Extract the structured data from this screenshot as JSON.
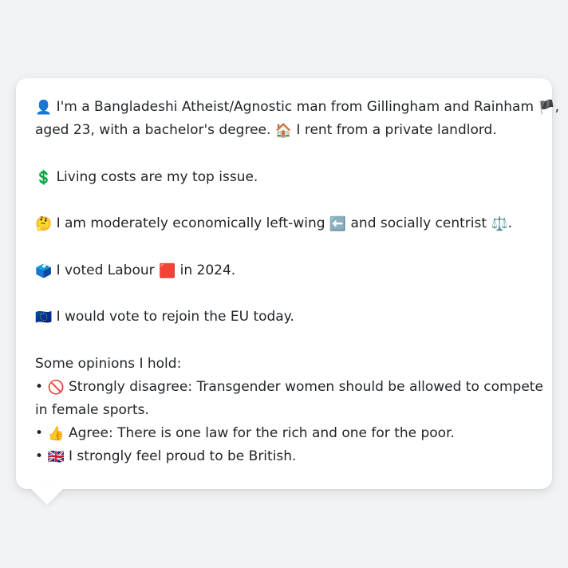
{
  "profile": {
    "line1_icon": "👤",
    "line1_text": "I'm a Bangladeshi Atheist/Agnostic man from Gillingham and Rainham",
    "line1_flag": "🏴",
    "line1_suffix": ",",
    "line2_text": "aged 23, with a bachelor's degree.",
    "line2_house_icon": "🏠",
    "line2_rest": "I rent from a private landlord."
  },
  "issue": {
    "icon": "💲",
    "text": "Living costs are my top issue."
  },
  "ideology": {
    "think_icon": "🤔",
    "text_a": "I am moderately economically left-wing",
    "left_arrow_icon": "⬅️",
    "text_b": "and socially centrist",
    "scales_icon": "⚖️",
    "text_end": "."
  },
  "vote": {
    "ballot_icon": "🗳️",
    "text_a": "I voted Labour",
    "party_square_icon": "🟥",
    "text_b": "in 2024."
  },
  "eu": {
    "flag_icon": "🇪🇺",
    "text": "I would vote to rejoin the EU today."
  },
  "opinions": {
    "heading": "Some opinions I hold:",
    "items": [
      {
        "bullet": "•",
        "icon": "🚫",
        "text_line1": "Strongly disagree: Transgender women should be allowed to compete",
        "text_line2": "in female sports."
      },
      {
        "bullet": "•",
        "icon": "👍",
        "text_line1": "Agree: There is one law for the rich and one for the poor."
      },
      {
        "bullet": "•",
        "icon": "🇬🇧",
        "text_line1": "I strongly feel proud to be British."
      }
    ]
  },
  "colors": {
    "background": "#f2f3f5",
    "bubble": "#ffffff",
    "text": "#1f2328"
  }
}
